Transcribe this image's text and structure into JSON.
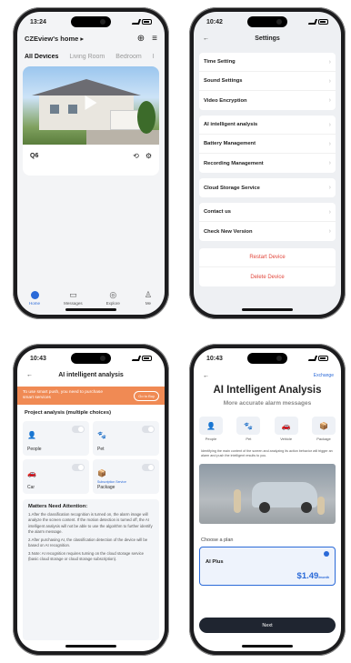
{
  "screen1": {
    "time": "13:24",
    "home_name": "CZEview's home ▸",
    "tabs": [
      "All Devices",
      "Living Room",
      "Bedroom",
      "I"
    ],
    "camera_name": "Q6",
    "tabbar": [
      "Home",
      "Messages",
      "Explore",
      "Me"
    ],
    "icons": [
      "plus-icon",
      "menu-icon",
      "history-icon",
      "settings-icon"
    ]
  },
  "screen2": {
    "time": "10:42",
    "title": "Settings",
    "group1": [
      "Time Setting",
      "Sound Settings",
      "Video Encryption"
    ],
    "group2": [
      "AI intelligent analysis",
      "Battery Management",
      "Recording Management"
    ],
    "group3": [
      "Cloud Storage Service"
    ],
    "group4": [
      "Contact us",
      "Check New Version"
    ],
    "restart": "Restart Device",
    "delete": "Delete Device"
  },
  "screen3": {
    "time": "10:43",
    "title": "AI intelligent analysis",
    "banner_text": "To use smart push, you need to purchase smart services",
    "banner_button": "Go to Buy",
    "subtitle": "Project analysis (multiple choices)",
    "items": [
      {
        "label": "People",
        "sub": ""
      },
      {
        "label": "Pet",
        "sub": ""
      },
      {
        "label": "Car",
        "sub": ""
      },
      {
        "label": "Package",
        "sub": "Subscription Service"
      }
    ],
    "attention_title": "Matters Need Attention:",
    "attention_paragraphs": [
      "1.After the classification recognition is turned on, the alarm image will analyze the screen content. If the motion detection is turned off, the AI intelligent analysis will not be able to use the algorithm to further identify the alarm message.",
      "2.After purchasing AI, the classification detection of the device will be based on AI recognition.",
      "3.Note: AI recognition requires turning on the cloud storage service (basic cloud storage or cloud storage subscription)."
    ]
  },
  "screen4": {
    "time": "10:43",
    "exchange": "Exchange",
    "title": "AI Intelligent Analysis",
    "subtitle": "More accurate alarm messages",
    "icons": [
      "People",
      "Pet",
      "Vehicle",
      "Package"
    ],
    "description": "Identifying the main content of the screen and analyzing its action behavior will trigger an alarm and push the intelligent results to you.",
    "choose": "Choose a plan",
    "plan_name": "AI Plus",
    "plan_price": "$1.49",
    "plan_period": "/month",
    "next": "Next"
  }
}
